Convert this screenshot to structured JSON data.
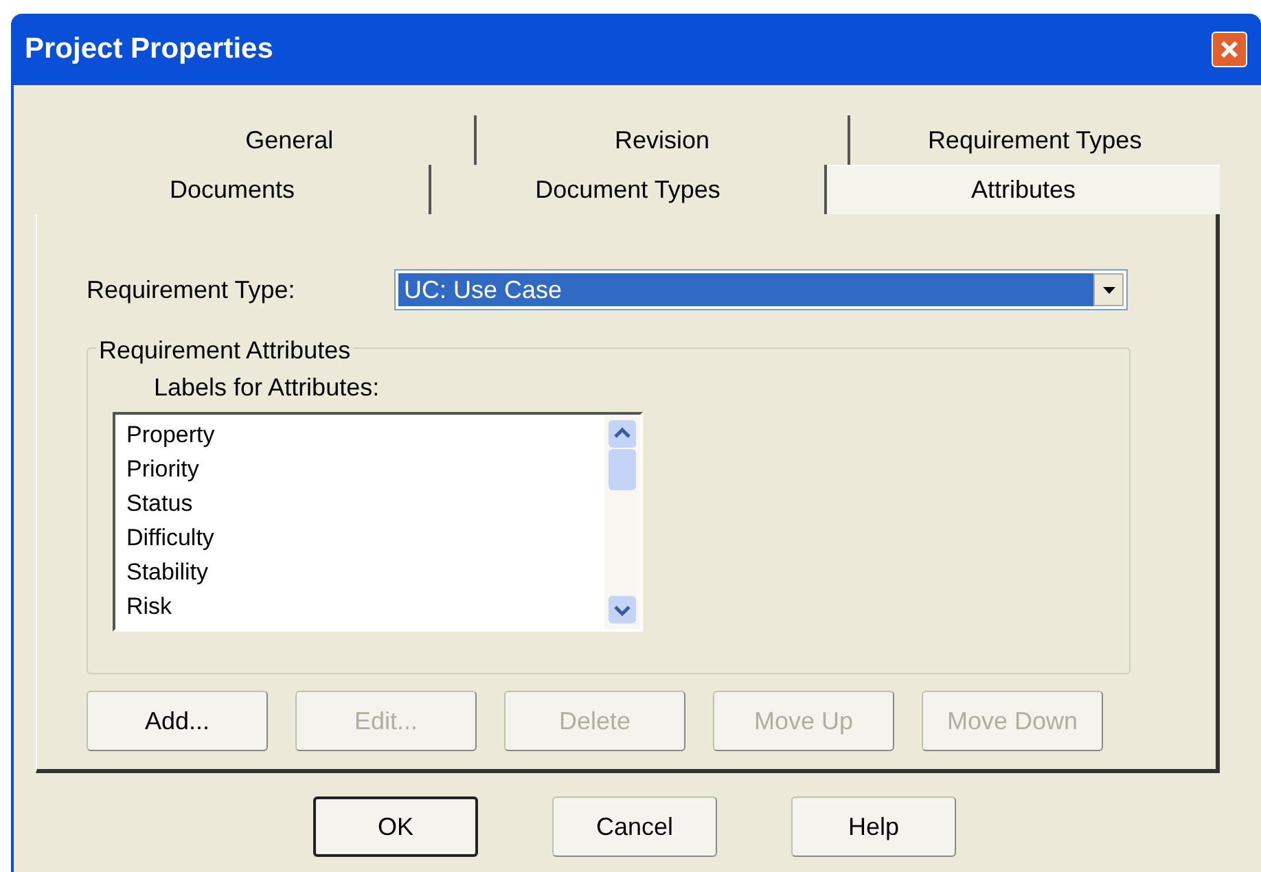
{
  "window": {
    "title": "Project Properties"
  },
  "tab_rows": [
    [
      {
        "label": "General",
        "selected": false
      },
      {
        "label": "Revision",
        "selected": false
      },
      {
        "label": "Requirement Types",
        "selected": false
      }
    ],
    [
      {
        "label": "Documents",
        "selected": false
      },
      {
        "label": "Document Types",
        "selected": false
      },
      {
        "label": "Attributes",
        "selected": true
      }
    ]
  ],
  "requirement_type": {
    "label": "Requirement Type:",
    "value": "UC: Use Case"
  },
  "attributes_group": {
    "title": "Requirement Attributes",
    "list_label": "Labels for Attributes:",
    "items": [
      "Property",
      "Priority",
      "Status",
      "Difficulty",
      "Stability",
      "Risk"
    ]
  },
  "list_buttons": [
    {
      "label": "Add...",
      "disabled": false
    },
    {
      "label": "Edit...",
      "disabled": true
    },
    {
      "label": "Delete",
      "disabled": true
    },
    {
      "label": "Move Up",
      "disabled": true
    },
    {
      "label": "Move Down",
      "disabled": true
    }
  ],
  "dialog_buttons": [
    {
      "label": "OK",
      "default": true
    },
    {
      "label": "Cancel",
      "default": false
    },
    {
      "label": "Help",
      "default": false
    }
  ]
}
